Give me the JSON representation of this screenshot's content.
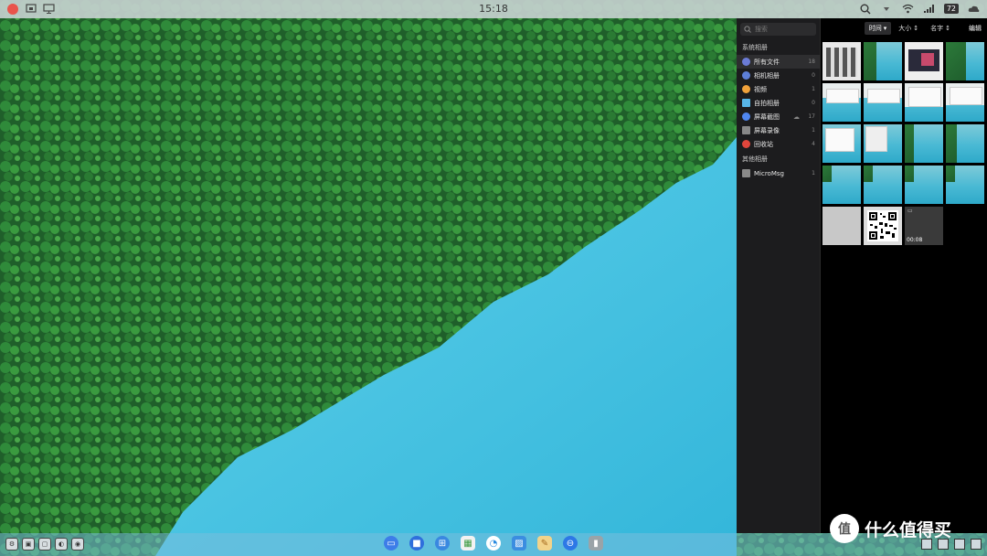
{
  "topbar": {
    "time": "15:18",
    "battery": "72",
    "left_icons": [
      "close-icon",
      "screenshot-icon",
      "monitor-icon"
    ],
    "right_icons": [
      "search-icon",
      "dropdown-icon",
      "wifi-icon",
      "signal-icon",
      "battery-icon",
      "cloud-icon"
    ]
  },
  "gallery": {
    "search_placeholder": "搜索",
    "system_section": "系统相册",
    "other_section": "其他相册",
    "albums": [
      {
        "name": "所有文件",
        "count": "18",
        "color": "#6b7bd6",
        "active": true
      },
      {
        "name": "相机相册",
        "count": "0",
        "color": "#5d7fd8"
      },
      {
        "name": "视频",
        "count": "1",
        "color": "#f0a13a"
      },
      {
        "name": "自拍相册",
        "count": "0",
        "color": "#58b6e8"
      },
      {
        "name": "屏幕截图",
        "count": "17",
        "color": "#4f86f0",
        "cloud": true
      },
      {
        "name": "屏幕录像",
        "count": "1",
        "color": "#888888"
      },
      {
        "name": "回收站",
        "count": "4",
        "color": "#e0463c"
      }
    ],
    "other_albums": [
      {
        "name": "MicroMsg",
        "count": "1",
        "color": "#8a8a8a"
      }
    ],
    "sort": {
      "time": "时间",
      "size": "大小",
      "name": "名字",
      "edit": "编辑"
    },
    "video_duration": "00:08"
  },
  "dock": {
    "apps": [
      "finder-icon",
      "files-icon",
      "launcher-icon",
      "photos-icon",
      "browser-icon",
      "gallery-icon",
      "notes-icon",
      "settings-icon",
      "trash-icon"
    ]
  },
  "watermark": {
    "logo": "值",
    "text": "什么值得买"
  },
  "colors": {
    "accent": "#4f86f0",
    "dock": "#78bedc",
    "panel": "#1c1c1e"
  }
}
